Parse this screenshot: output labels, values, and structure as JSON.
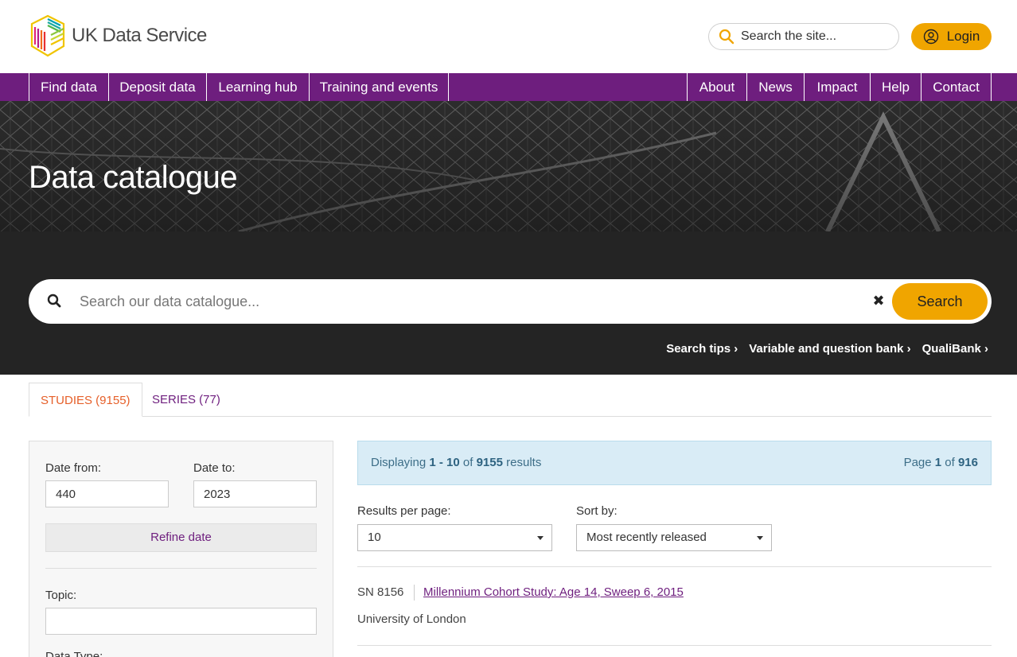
{
  "header": {
    "logo_text": "UK Data Service",
    "site_search_placeholder": "Search the site...",
    "login_label": "Login"
  },
  "nav": {
    "left": [
      "Find data",
      "Deposit data",
      "Learning hub",
      "Training and events"
    ],
    "right": [
      "About",
      "News",
      "Impact",
      "Help",
      "Contact"
    ]
  },
  "hero": {
    "title": "Data catalogue"
  },
  "catalogue_search": {
    "placeholder": "Search our data catalogue...",
    "clear_symbol": "✖",
    "button_label": "Search",
    "links": [
      "Search tips",
      "Variable and question bank",
      "QualiBank"
    ],
    "link_chevron": "›"
  },
  "tabs": [
    {
      "label": "STUDIES (9155)",
      "active": true
    },
    {
      "label": "SERIES (77)",
      "active": false
    }
  ],
  "filters": {
    "date_from_label": "Date from:",
    "date_from_value": "440",
    "date_to_label": "Date to:",
    "date_to_value": "2023",
    "refine_label": "Refine date",
    "topic_label": "Topic:",
    "topic_value": "",
    "data_type_label": "Data Type:"
  },
  "results": {
    "displaying_prefix": "Displaying ",
    "range": "1 - 10",
    "of_text": " of ",
    "total": "9155",
    "results_word": " results",
    "page_prefix": "Page ",
    "page": "1",
    "page_of": " of ",
    "page_total": "916",
    "per_page_label": "Results per page:",
    "per_page_value": "10",
    "sort_label": "Sort by:",
    "sort_value": "Most recently released",
    "items": [
      {
        "sn": "SN 8156",
        "title": "Millennium Cohort Study: Age 14, Sweep 6, 2015",
        "org": "University of London"
      }
    ]
  },
  "colors": {
    "brand_purple": "#6e1e7e",
    "accent_yellow": "#f0a500",
    "active_tab_orange": "#e6602a",
    "info_blue": "#d9ecf6"
  },
  "icons": [
    "search-icon",
    "user-icon",
    "clear-icon",
    "chevron-right-icon",
    "caret-down-icon"
  ]
}
